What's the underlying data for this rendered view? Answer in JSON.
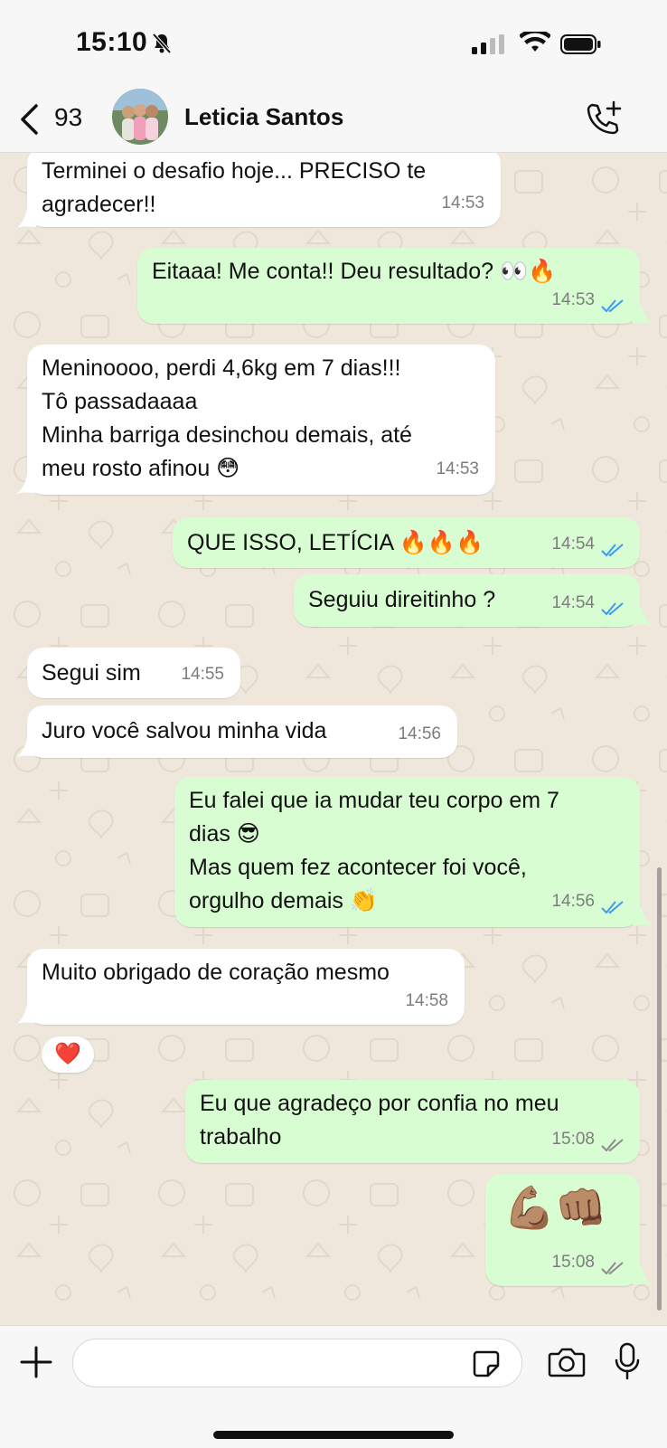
{
  "status_bar": {
    "time": "15:10",
    "icons": [
      "bell-slash-icon",
      "cellular-signal-icon",
      "wifi-icon",
      "battery-icon"
    ]
  },
  "header": {
    "unread_count": "93",
    "contact_name": "Leticia Santos",
    "icons": [
      "chevron-left-icon",
      "add-call-icon"
    ]
  },
  "messages": [
    {
      "dir": "in",
      "text": "Terminei o desafio hoje... PRECISO te\nagradecer!!",
      "time": "14:53"
    },
    {
      "dir": "out",
      "text": "Eitaaa! Me conta!! Deu resultado? 👀🔥",
      "time": "14:53",
      "status": "read"
    },
    {
      "dir": "in",
      "text": "Meninoooo, perdi 4,6kg em 7 dias!!!\nTô passadaaaa\nMinha barriga desinchou demais, até\nmeu rosto afinou 😳",
      "time": "14:53"
    },
    {
      "dir": "out",
      "text": "QUE ISSO, LETÍCIA 🔥🔥🔥",
      "time": "14:54",
      "status": "read"
    },
    {
      "dir": "out",
      "text": "Seguiu direitinho ?",
      "time": "14:54",
      "status": "read"
    },
    {
      "dir": "in",
      "text": "Segui sim",
      "time": "14:55"
    },
    {
      "dir": "in",
      "text": "Juro você salvou minha vida",
      "time": "14:56"
    },
    {
      "dir": "out",
      "text": "Eu falei que ia mudar teu corpo em 7\ndias 😎\nMas quem fez acontecer foi você,\norgulho demais 👏",
      "time": "14:56",
      "status": "read"
    },
    {
      "dir": "in",
      "text": "Muito obrigado de coração mesmo",
      "time": "14:58",
      "reaction": "❤️"
    },
    {
      "dir": "out",
      "text": "Eu que agradeço por confia no meu\ntrabalho",
      "time": "15:08",
      "status": "delivered"
    },
    {
      "dir": "out",
      "text": "💪🏽👊🏽",
      "time": "15:08",
      "status": "delivered"
    }
  ],
  "composer": {
    "placeholder": "",
    "icons": [
      "plus-icon",
      "sticker-icon",
      "camera-icon",
      "microphone-icon"
    ]
  },
  "colors": {
    "outgoing_bubble": "#d9fdd3",
    "incoming_bubble": "#ffffff",
    "chat_background": "#efe7db",
    "read_ticks": "#3b9bf0",
    "delivered_ticks": "#8c8c8c"
  }
}
